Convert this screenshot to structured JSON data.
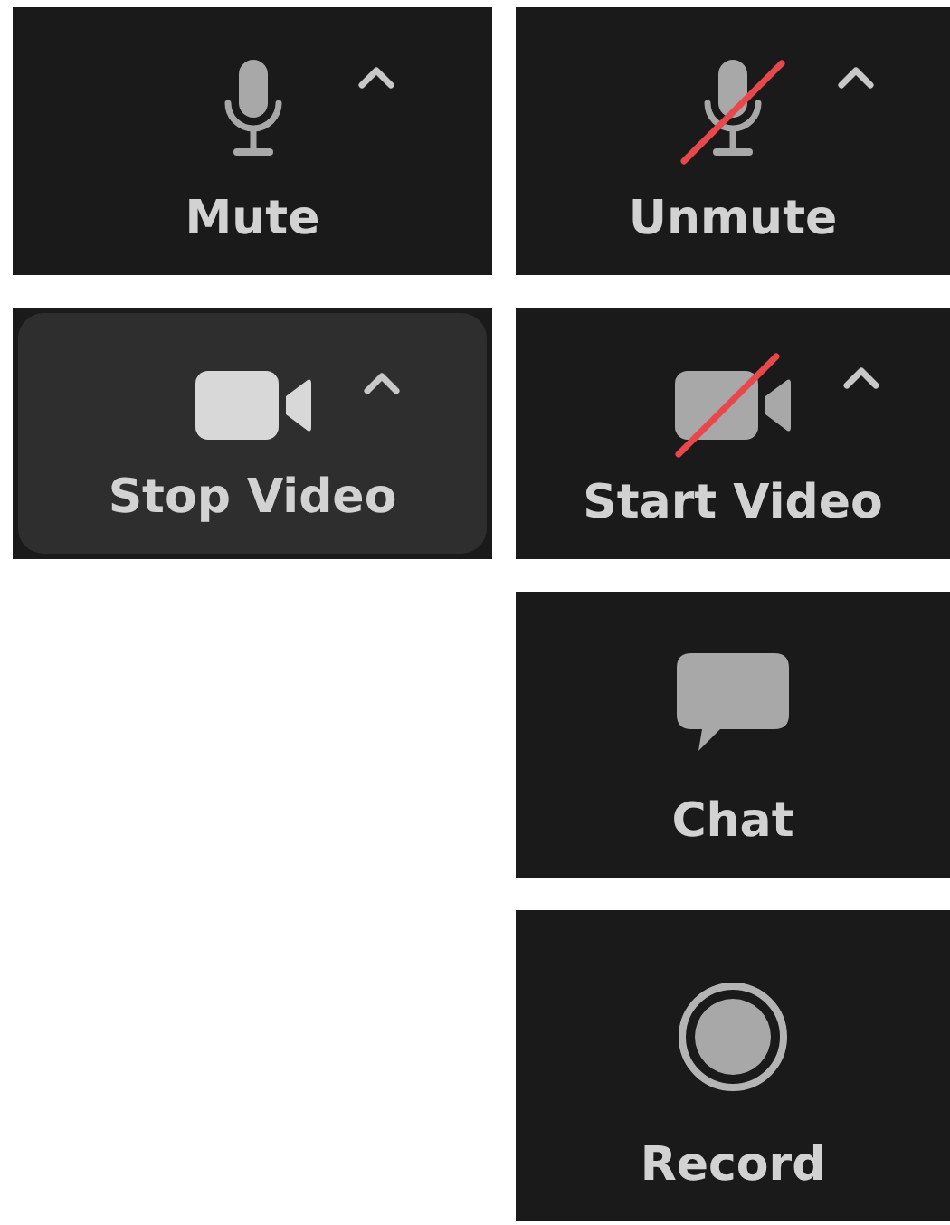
{
  "left_column": [
    {
      "kind": "microphone",
      "label": "Mute",
      "muted": false,
      "has_menu": true,
      "highlighted": false
    },
    {
      "kind": "video",
      "label": "Stop Video",
      "muted": false,
      "has_menu": true,
      "highlighted": true
    }
  ],
  "right_column": [
    {
      "kind": "microphone",
      "label": "Unmute",
      "muted": true,
      "has_menu": true,
      "highlighted": false
    },
    {
      "kind": "video",
      "label": "Start Video",
      "muted": true,
      "has_menu": true,
      "highlighted": false
    },
    {
      "kind": "chat",
      "label": "Chat",
      "muted": false,
      "has_menu": false,
      "highlighted": false
    },
    {
      "kind": "record",
      "label": "Record",
      "muted": false,
      "has_menu": false,
      "highlighted": false
    }
  ]
}
